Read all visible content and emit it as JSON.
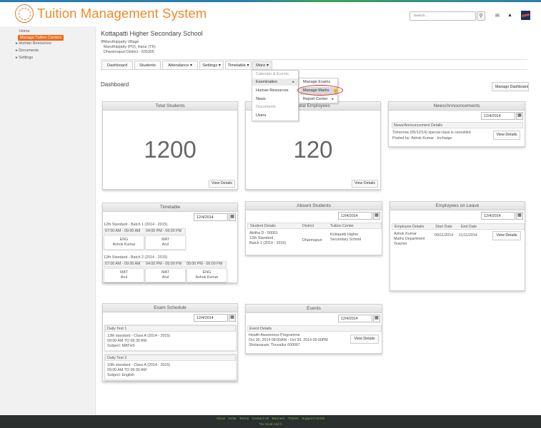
{
  "app": {
    "title": "Tuition Management System"
  },
  "header": {
    "search_placeholder": "Search..."
  },
  "sidebar": {
    "home": "Home",
    "active": "Manage Tuition Centers",
    "items": [
      "Human Resources",
      "Documents",
      "Settings"
    ]
  },
  "school": {
    "name": "Kottapatti Higher Secondary School",
    "address": [
      "Maruthippatty Village",
      "Maruthippatty (PO), Harur (TK)",
      "Dharamapuri District - 635305"
    ]
  },
  "nav": {
    "tabs": [
      "Dashboard",
      "Students",
      "Attendance ▾",
      "Settings ▾",
      "Timetable ▾",
      "More ▾"
    ]
  },
  "more_menu": [
    "Calendar & Events",
    "Examination",
    "Human Resources",
    "News",
    "Documents",
    "Users"
  ],
  "exam_submenu": [
    "Manage Exams",
    "Manage Marks",
    "Report Center"
  ],
  "dashboard": {
    "title": "Dashboard",
    "manage_button": "Manage Dashboards"
  },
  "total_students": {
    "title": "Total Students",
    "count": "1200",
    "button": "View Details"
  },
  "total_employees": {
    "title": "Total Employees",
    "count": "120",
    "button": "View Details"
  },
  "news": {
    "title": "News/Announcements",
    "date": "12/4/2014",
    "col_header": "News/Announcement Details",
    "line1": "Tomorrow (05/12/14) special class is cancelled",
    "line2": "Posted by: Ashok Kumar - Incharge",
    "button": "View Details"
  },
  "timetable": {
    "title": "Timetable",
    "date": "12/4/2014",
    "batch1": {
      "label": "12th Standard - Batch 1 (2014 - 2015)",
      "slots": [
        "07:00 AM - 09:00 AM",
        "04:00 PM - 06:00 PM"
      ],
      "cells": [
        [
          "ENG",
          "Ashok Kumar"
        ],
        [
          "MAT",
          "Arul"
        ]
      ]
    },
    "batch2": {
      "label": "12th Standard - Batch 2 (2014 - 2015)",
      "slots": [
        "07:00 AM - 09:00 AM",
        "04:00 PM - 05:00 PM",
        "05:00 PM - 06:00 PM"
      ],
      "cells": [
        [
          "MAT",
          "Arul"
        ],
        [
          "MAT",
          "Arul"
        ],
        [
          "ENG",
          "Ashok Kumar"
        ]
      ]
    }
  },
  "absent": {
    "title": "Absent Students",
    "date": "12/4/2014",
    "headers": [
      "Student Details",
      "District",
      "Tuition Center"
    ],
    "student": [
      "Abitha D - 50001",
      "12th Standard",
      "Batch 1 (2014 - 2015)"
    ],
    "district": "Dharmapuri",
    "center": [
      "Kottapatti Higher",
      "Secondary School"
    ]
  },
  "leave": {
    "title": "Employees on Leave",
    "date": "12/4/2014",
    "headers": [
      "Employee Details",
      "Start Date",
      "End Date"
    ],
    "employee": [
      "Ashok Kumar",
      "Maths Department",
      "Teacher"
    ],
    "start": "09/11/2014",
    "end": "11/11/2014",
    "button": "View Details"
  },
  "exam": {
    "title": "Exam Schedule",
    "date": "12/4/2014",
    "tests": [
      {
        "name": "Daily Test 1",
        "lines": [
          "12th standard - Class A (2014 - 2015)",
          "09:00 AM  TO  09:30 AM",
          "Subject: MATHS"
        ]
      },
      {
        "name": "Daily Test 2",
        "lines": [
          "10th standard - Class A (2014 - 2015)",
          "09:00 AM  TO  09:30 AM",
          "Subject: English"
        ]
      }
    ]
  },
  "events": {
    "title": "Events",
    "date": "12/4/2014",
    "col_header": "Event Details",
    "lines": [
      "Health Awareness Programme",
      "Oct 30, 2014  08:00AM  -  Oct 30, 2014  05:00PM",
      "Sholavaram, Tiruvallur 600067"
    ],
    "button": "View Details"
  },
  "footer": {
    "links": [
      "About",
      "Invite",
      "Terms",
      "Contact Us",
      "Banners",
      "Tickets",
      "Support Center"
    ],
    "copyright": "The Good Grid ©"
  }
}
